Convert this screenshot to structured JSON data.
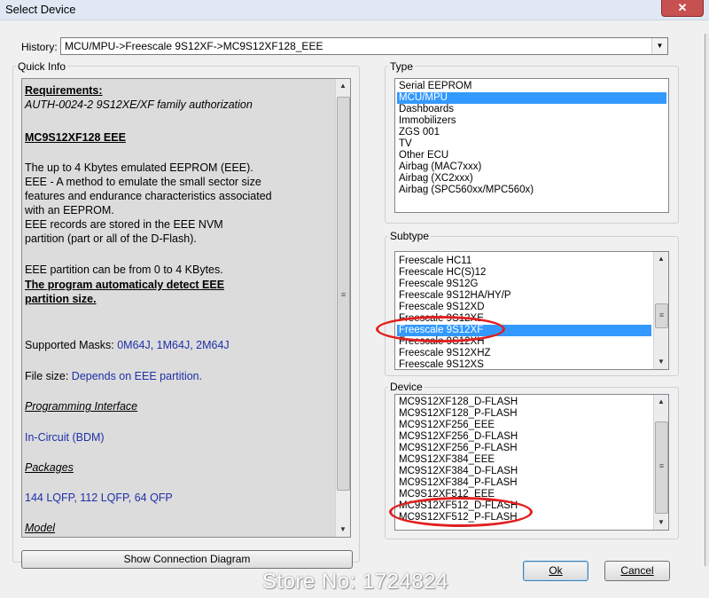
{
  "window": {
    "title": "Select Device",
    "close_glyph": "✕"
  },
  "history": {
    "label": "History:",
    "value": "MCU/MPU->Freescale 9S12XF->MC9S12XF128_EEE"
  },
  "quick_info": {
    "label": "Quick Info",
    "requirements_heading": "Requirements:",
    "requirements_text": "AUTH-0024-2  9S12XE/XF family authorization",
    "device_heading": "MC9S12XF128 EEE",
    "desc_lines": [
      "The up to 4 Kbytes emulated EEPROM (EEE).",
      "EEE - A method to emulate the small sector size",
      "features and endurance characteristics associated",
      "with an EEPROM.",
      "EEE records are stored in the EEE NVM",
      "partition (part or all of the D-Flash)."
    ],
    "partition_text": "EEE partition can be from 0 to 4 KBytes.",
    "auto_detect_lines": [
      "The program automaticaly detect EEE",
      "partition size."
    ],
    "masks_label": "Supported Masks: ",
    "masks_value": "0M64J, 1M64J, 2M64J",
    "filesize_label": "File size: ",
    "filesize_value": "Depends on EEE partition.",
    "prog_interface_heading": "Programming Interface",
    "prog_interface_value": "In-Circuit (BDM)",
    "packages_heading": "Packages",
    "packages_value": "144 LQFP, 112 LQFP,  64 QFP",
    "model_heading": "Model"
  },
  "type_group": {
    "label": "Type",
    "items": [
      "Serial EEPROM",
      "MCU/MPU",
      "Dashboards",
      "Immobilizers",
      "ZGS 001",
      "TV",
      "Other ECU",
      "Airbag (MAC7xxx)",
      "Airbag (XC2xxx)",
      "Airbag (SPC560xx/MPC560x)"
    ],
    "selected_index": 1
  },
  "subtype_group": {
    "label": "Subtype",
    "items": [
      "Freescale HC11",
      "Freescale HC(S)12",
      "Freescale 9S12G",
      "Freescale 9S12HA/HY/P",
      "Freescale 9S12XD",
      "Freescale 9S12XE",
      "Freescale 9S12XF",
      "Freescale 9S12XH",
      "Freescale 9S12XHZ",
      "Freescale 9S12XS"
    ],
    "selected_index": 6
  },
  "device_group": {
    "label": "Device",
    "items": [
      "MC9S12XF128_D-FLASH",
      "MC9S12XF128_P-FLASH",
      "MC9S12XF256_EEE",
      "MC9S12XF256_D-FLASH",
      "MC9S12XF256_P-FLASH",
      "MC9S12XF384_EEE",
      "MC9S12XF384_D-FLASH",
      "MC9S12XF384_P-FLASH",
      "MC9S12XF512_EEE",
      "MC9S12XF512_D-FLASH",
      "MC9S12XF512_P-FLASH"
    ]
  },
  "buttons": {
    "connection": "Show Connection Diagram",
    "ok": "Ok",
    "cancel": "Cancel"
  },
  "watermark": "Store No: 1724824",
  "colors": {
    "selection": "#3399ff",
    "link_blue": "#1f2fa8",
    "annotation_red": "#e02020"
  }
}
